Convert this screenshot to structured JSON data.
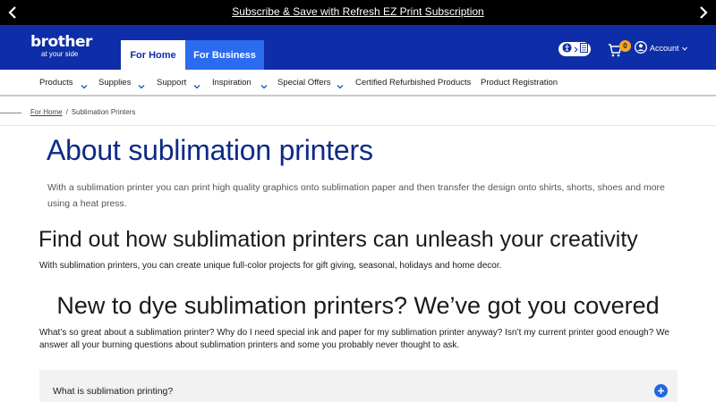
{
  "promo": {
    "text": "Subscribe & Save with Refresh EZ Print Subscription"
  },
  "header": {
    "logo_brand": "brother",
    "logo_tagline": "at your side",
    "tabs": [
      {
        "label": "For Home",
        "active": true
      },
      {
        "label": "For Business",
        "active": false
      }
    ],
    "cart_count": "0",
    "account_label": "Account",
    "brand_color": "#0d2ea8",
    "accent_color": "#2b6bf0"
  },
  "nav": {
    "items": [
      {
        "label": "Products",
        "has_menu": true
      },
      {
        "label": "Supplies",
        "has_menu": true
      },
      {
        "label": "Support",
        "has_menu": true
      },
      {
        "label": "Inspiration",
        "has_menu": true
      },
      {
        "label": "Special Offers",
        "has_menu": true
      },
      {
        "label": "Certified Refurbished Products",
        "has_menu": false
      },
      {
        "label": "Product Registration",
        "has_menu": false
      }
    ]
  },
  "breadcrumb": {
    "home": "For Home",
    "separator": "/",
    "current": "Sublimation Printers"
  },
  "content": {
    "title": "About sublimation printers",
    "intro": "With a sublimation printer you can print high quality graphics onto sublimation paper and then transfer the design onto shirts, shorts, shoes and more using a heat press.",
    "heading1": "Find out how sublimation printers can unleash your creativity",
    "para1": "With sublimation printers, you can create unique full-color projects for gift giving, seasonal, holidays and home decor.",
    "heading2": "New to dye sublimation printers? We’ve got you covered",
    "para2": "What’s so great about a sublimation printer? Why do I need special ink and paper for my sublimation printer anyway? Isn’t my current printer good enough? We answer all your burning questions about sublimation printers and some you probably never thought to ask.",
    "faq_question": "What is sublimation printing?"
  }
}
